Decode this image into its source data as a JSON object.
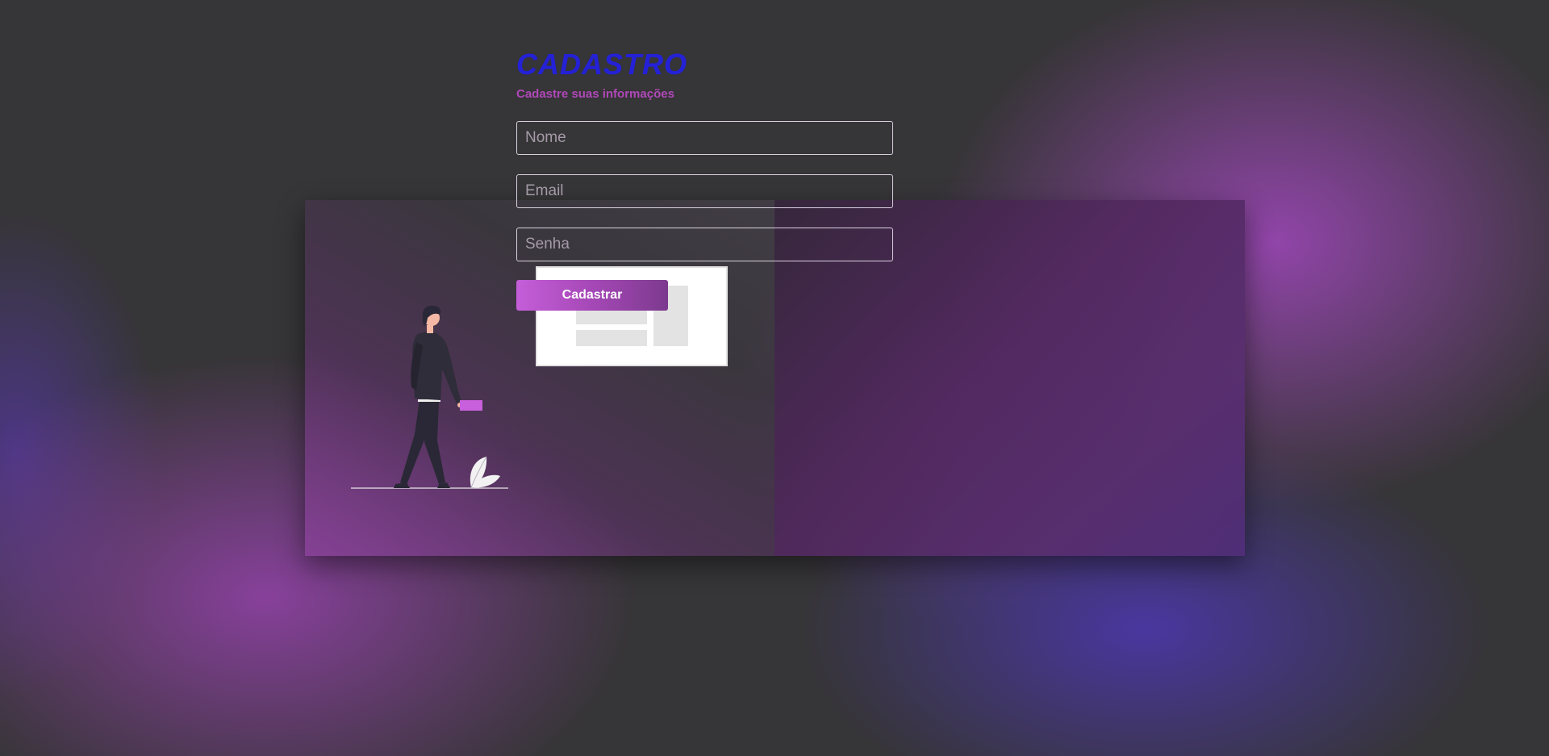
{
  "form": {
    "title": "CADASTRO",
    "subtitle": "Cadastre suas informações",
    "fields": [
      {
        "name": "nome",
        "placeholder": "Nome",
        "value": ""
      },
      {
        "name": "email",
        "placeholder": "Email",
        "value": ""
      },
      {
        "name": "senha",
        "placeholder": "Senha",
        "value": ""
      }
    ],
    "submit_label": "Cadastrar"
  },
  "illustration": {
    "icon": "person-walking-with-card-illustration"
  },
  "colors": {
    "title": "#2421d6",
    "subtitle": "#b048b9",
    "accent": "#c55ed9",
    "background": "#363537"
  }
}
